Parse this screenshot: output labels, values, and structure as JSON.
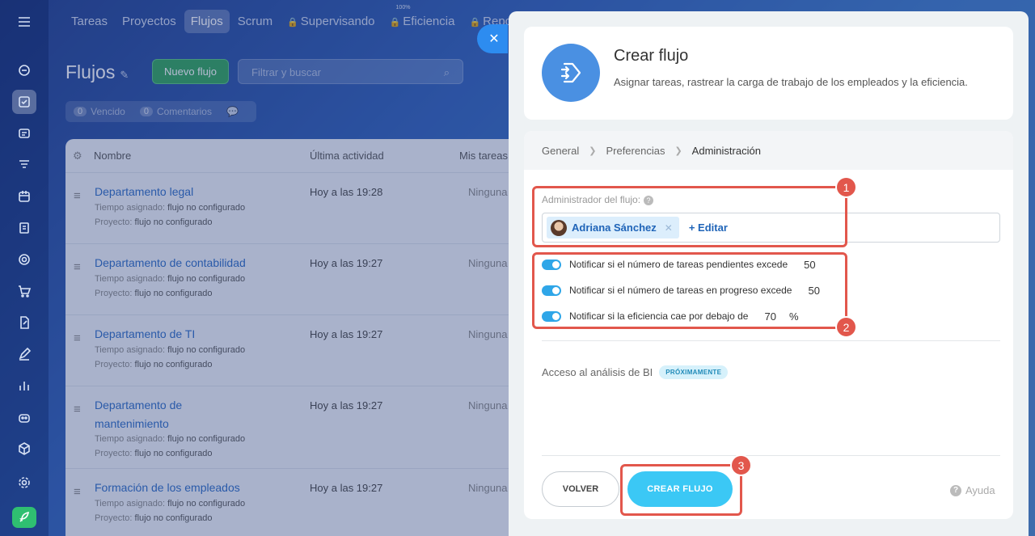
{
  "nav": {
    "tabs": [
      {
        "label": "Tareas"
      },
      {
        "label": "Proyectos"
      },
      {
        "label": "Flujos"
      },
      {
        "label": "Scrum"
      },
      {
        "label": "Supervisando"
      },
      {
        "label": "Eficiencia",
        "superscript": "100%"
      },
      {
        "label": "Repo"
      }
    ]
  },
  "page": {
    "title": "Flujos",
    "new_button": "Nuevo flujo",
    "search_placeholder": "Filtrar y buscar",
    "counters": [
      {
        "count": "0",
        "label": "Vencido"
      },
      {
        "count": "0",
        "label": "Comentarios"
      }
    ]
  },
  "table": {
    "headers": {
      "name": "Nombre",
      "activity": "Última actividad",
      "tasks": "Mis tareas"
    },
    "meta_labels": {
      "time": "Tiempo asignado:",
      "project": "Proyecto:"
    },
    "rows": [
      {
        "name": "Departamento legal",
        "time": "flujo no configurado",
        "project": "flujo no configurado",
        "activity": "Hoy a las 19:28",
        "tasks": "Ninguna"
      },
      {
        "name": "Departamento de contabilidad",
        "time": "flujo no configurado",
        "project": "flujo no configurado",
        "activity": "Hoy a las 19:27",
        "tasks": "Ninguna"
      },
      {
        "name": "Departamento de TI",
        "time": "flujo no configurado",
        "project": "flujo no configurado",
        "activity": "Hoy a las 19:27",
        "tasks": "Ninguna"
      },
      {
        "name_line1": "Departamento de",
        "name_line2": "mantenimiento",
        "time": "flujo no configurado",
        "project": "flujo no configurado",
        "activity": "Hoy a las 19:27",
        "tasks": "Ninguna"
      },
      {
        "name": "Formación de los empleados",
        "time": "flujo no configurado",
        "project": "flujo no configurado",
        "activity": "Hoy a las 19:27",
        "tasks": "Ninguna"
      }
    ]
  },
  "panel": {
    "title": "Crear flujo",
    "description": "Asignar tareas, rastrear la carga de trabajo de los empleados y la eficiencia.",
    "steps": [
      "General",
      "Preferencias",
      "Administración"
    ],
    "admin_label": "Administrador del flujo:",
    "admin_user": "Adriana Sánchez",
    "edit_label": "+ Editar",
    "notifications": [
      {
        "label": "Notificar si el número de tareas pendientes excede",
        "value": "50",
        "unit": "",
        "enabled": true
      },
      {
        "label": "Notificar si el número de tareas en progreso excede",
        "value": "50",
        "unit": "",
        "enabled": true
      },
      {
        "label": "Notificar si la eficiencia cae por debajo de",
        "value": "70",
        "unit": "%",
        "enabled": true
      }
    ],
    "bi_label": "Acceso al análisis de BI",
    "bi_badge": "PRÓXIMAMENTE",
    "back_button": "VOLVER",
    "create_button": "CREAR FLUJO",
    "help_label": "Ayuda"
  },
  "annotations": [
    "1",
    "2",
    "3"
  ],
  "colors": {
    "highlight": "#e2574c",
    "primary": "#3bc8f5",
    "link": "#2b6ac4",
    "new_button": "#2fa35a"
  }
}
